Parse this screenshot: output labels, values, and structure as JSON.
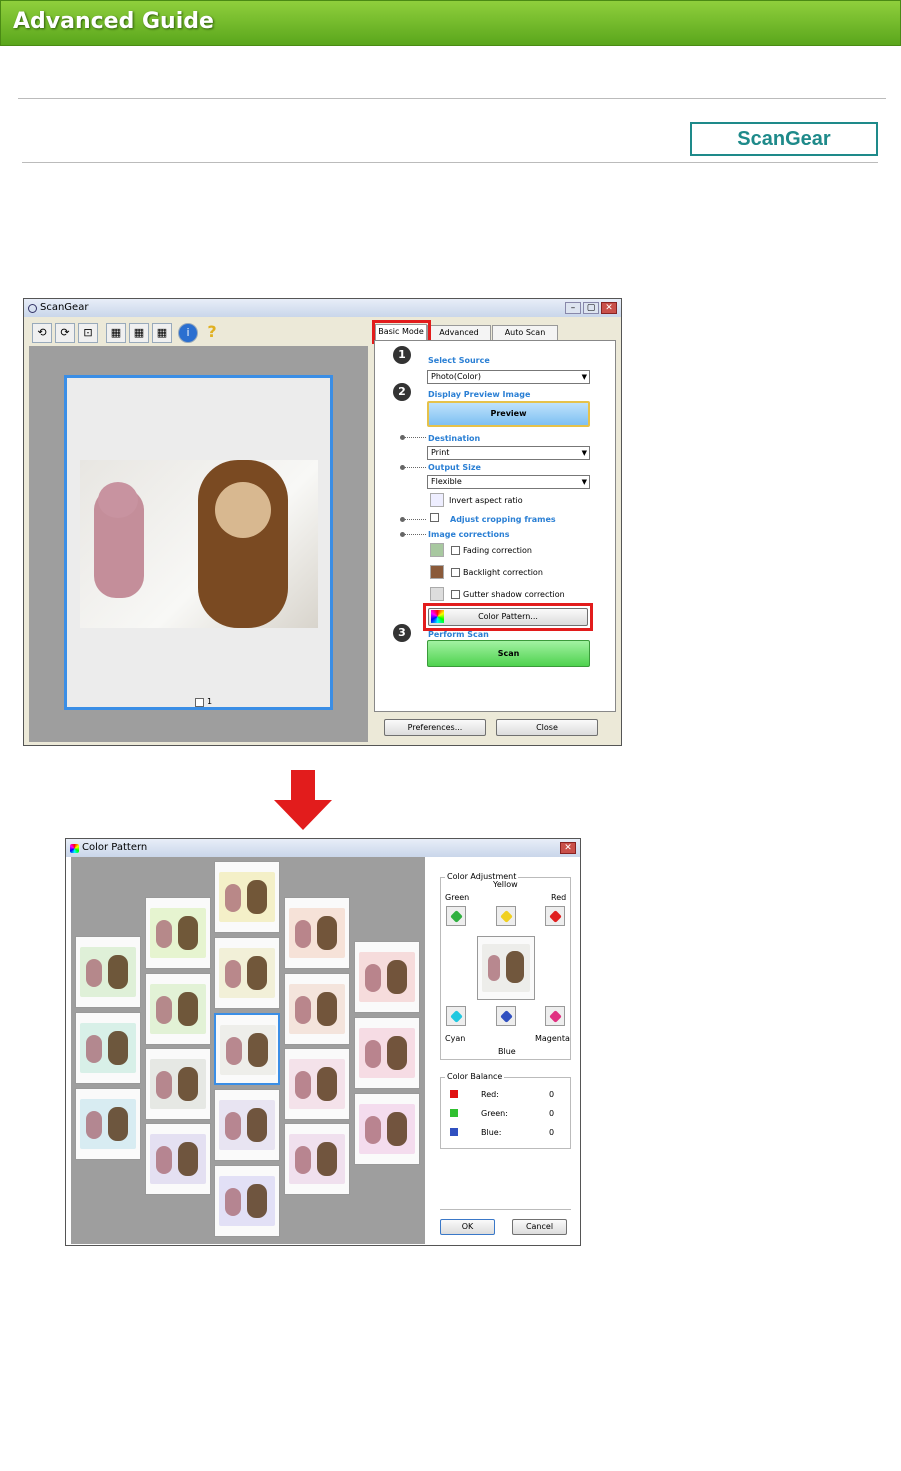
{
  "banner": {
    "title": "Advanced Guide"
  },
  "logo": "ScanGear",
  "scangear": {
    "title": "ScanGear",
    "window_controls": [
      "–",
      "▢",
      "✕"
    ],
    "tabs": [
      {
        "label": "Basic Mode"
      },
      {
        "label": "Advanced Mode"
      },
      {
        "label": "Auto Scan Mode"
      }
    ],
    "steps": {
      "s1": "1",
      "s2": "2",
      "s3": "3"
    },
    "select_source": {
      "label": "Select Source",
      "value": "Photo(Color)"
    },
    "display_preview": {
      "label": "Display Preview Image",
      "button": "Preview"
    },
    "destination": {
      "label": "Destination",
      "value": "Print"
    },
    "output_size": {
      "label": "Output Size",
      "value": "Flexible"
    },
    "invert_aspect": "Invert aspect ratio",
    "adjust_crop": "Adjust cropping frames",
    "image_corrections": {
      "label": "Image corrections",
      "fading": "Fading correction",
      "backlight": "Backlight correction",
      "gutter": "Gutter shadow correction"
    },
    "color_pattern_button": "Color Pattern...",
    "perform_scan": {
      "label": "Perform Scan",
      "button": "Scan"
    },
    "preview_frame_label": "1",
    "preferences_button": "Preferences...",
    "close_button": "Close"
  },
  "colorpattern": {
    "title": "Color Pattern",
    "close": "✕",
    "color_adjustment": {
      "label": "Color Adjustment",
      "yellow": "Yellow",
      "green": "Green",
      "red": "Red",
      "cyan": "Cyan",
      "magenta": "Magenta",
      "blue": "Blue"
    },
    "color_balance": {
      "label": "Color Balance",
      "rows": [
        {
          "name": "Red:",
          "value": "0",
          "color": "#e01010"
        },
        {
          "name": "Green:",
          "value": "0",
          "color": "#30c030"
        },
        {
          "name": "Blue:",
          "value": "0",
          "color": "#3050c0"
        }
      ]
    },
    "ok": "OK",
    "cancel": "Cancel"
  },
  "colors": {
    "accent_red": "#e21c1c",
    "banner_green": "#6bb42a",
    "logo_teal": "#1e8a8a"
  }
}
